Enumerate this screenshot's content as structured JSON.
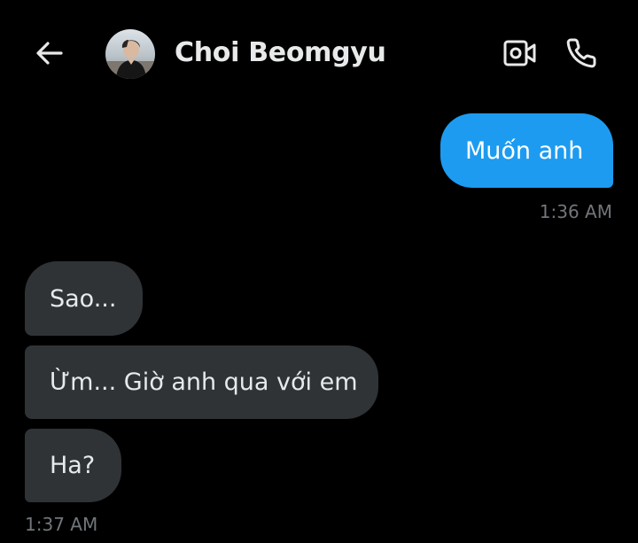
{
  "header": {
    "contact_name": "Choi Beomgyu"
  },
  "icons": {
    "back": "arrow-left-icon",
    "video": "video-camera-icon",
    "call": "phone-icon"
  },
  "colors": {
    "background": "#000000",
    "sent_bubble": "#1d9bf0",
    "received_bubble": "#2f3336",
    "timestamp": "#71767b"
  },
  "messages": [
    {
      "direction": "sent",
      "text": "Muốn anh"
    },
    {
      "direction": "received",
      "text": "Sao..."
    },
    {
      "direction": "received",
      "text": "Ừm... Giờ anh qua với em"
    },
    {
      "direction": "received",
      "text": "Ha?"
    }
  ],
  "timestamps": {
    "sent_group": "1:36 AM",
    "received_group": "1:37 AM"
  }
}
